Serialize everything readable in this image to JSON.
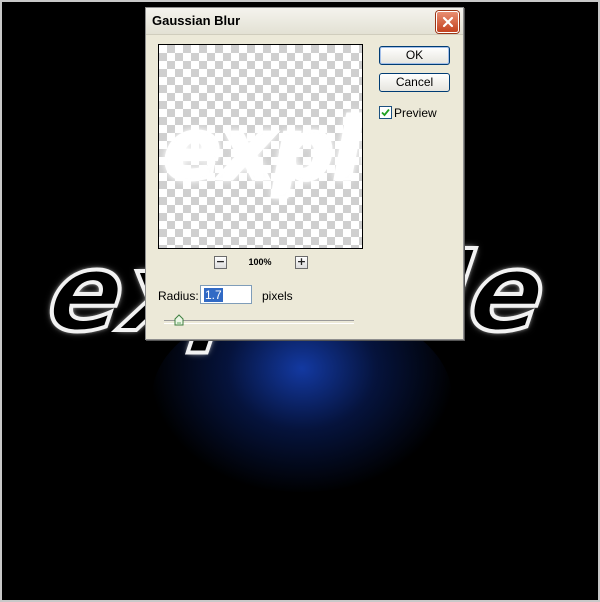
{
  "background": {
    "text": "explode",
    "glow_color": "#1a3fa0"
  },
  "dialog": {
    "title": "Gaussian Blur",
    "close_icon": "close-icon",
    "preview": {
      "text": "explode",
      "zoom_level": "100%",
      "zoom_out_symbol": "−",
      "zoom_in_symbol": "+"
    },
    "buttons": {
      "ok_label": "OK",
      "cancel_label": "Cancel"
    },
    "preview_checkbox": {
      "label": "Preview",
      "checked": true
    },
    "radius": {
      "label": "Radius:",
      "value": "1.7",
      "unit": "pixels",
      "slider_fraction": 0.08
    }
  },
  "colors": {
    "ok_border": "#003c74",
    "close_red": "#c4421f",
    "selection": "#316ac5"
  }
}
